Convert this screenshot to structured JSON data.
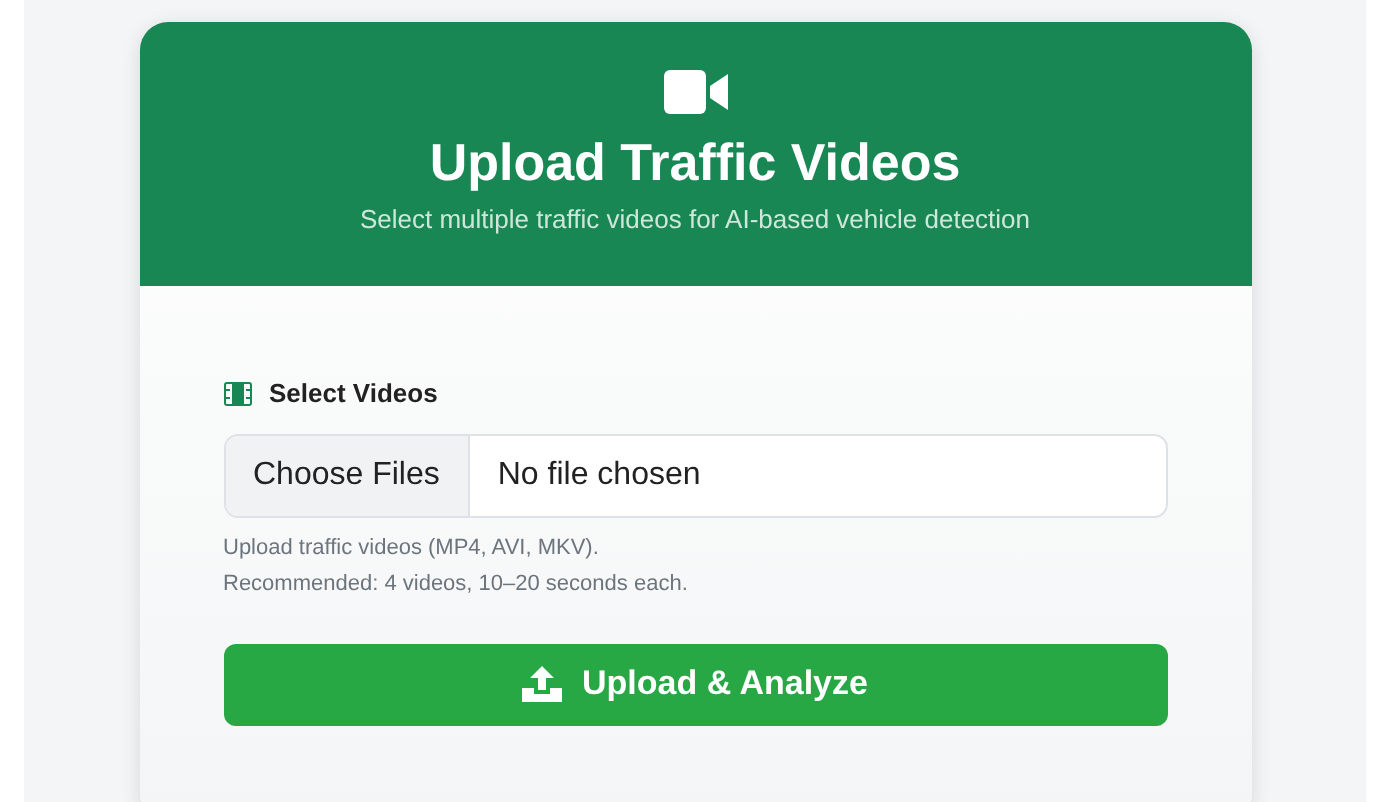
{
  "header": {
    "title": "Upload Traffic Videos",
    "subtitle": "Select multiple traffic videos for AI-based vehicle detection"
  },
  "field": {
    "label": "Select Videos",
    "button": "Choose Files",
    "value": "No file chosen"
  },
  "help_lines": [
    "Upload traffic videos (MP4, AVI, MKV).",
    "Recommended: 4 videos, 10–20 seconds each."
  ],
  "submit": {
    "label": "Upload & Analyze"
  }
}
